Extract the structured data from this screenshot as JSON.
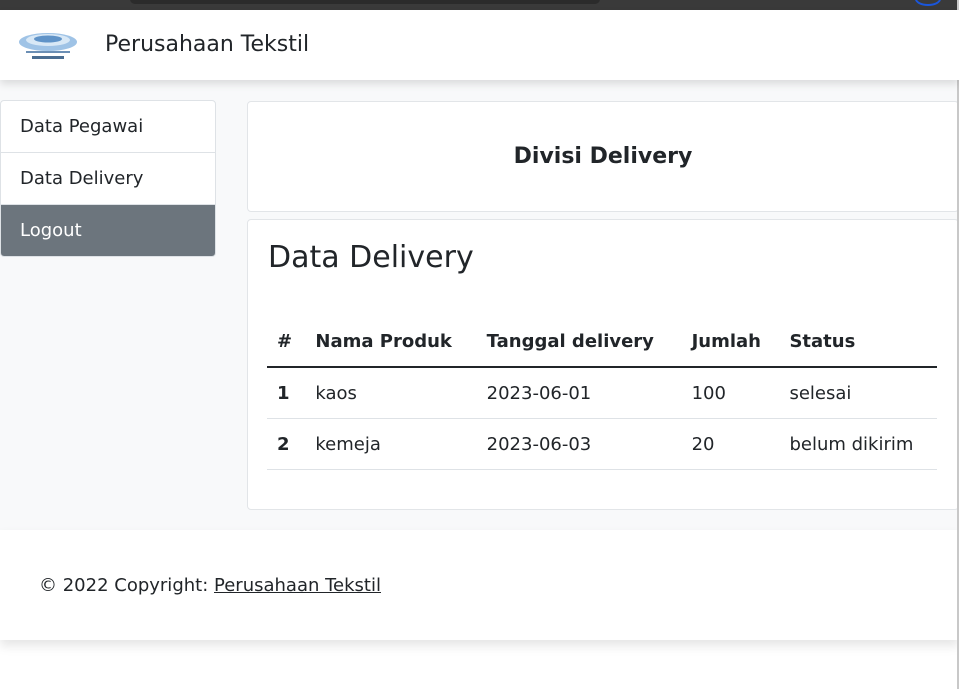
{
  "navbar": {
    "brand": "Perusahaan Tekstil",
    "logo_icon": "company-logo-icon"
  },
  "sidebar": {
    "items": [
      {
        "label": "Data Pegawai",
        "active": false
      },
      {
        "label": "Data Delivery",
        "active": false
      },
      {
        "label": "Logout",
        "active": true
      }
    ]
  },
  "header_card": {
    "title": "Divisi Delivery"
  },
  "data_card": {
    "title": "Data Delivery",
    "table": {
      "headers": [
        "#",
        "Nama Produk",
        "Tanggal delivery",
        "Jumlah",
        "Status"
      ],
      "rows": [
        [
          "1",
          "kaos",
          "2023-06-01",
          "100",
          "selesai"
        ],
        [
          "2",
          "kemeja",
          "2023-06-03",
          "20",
          "belum dikirim"
        ]
      ]
    }
  },
  "footer": {
    "prefix": "© 2022 Copyright: ",
    "link": "Perusahaan Tekstil"
  },
  "colors": {
    "active_sidebar": "#6c757d",
    "page_bg": "#f8f9fa"
  }
}
